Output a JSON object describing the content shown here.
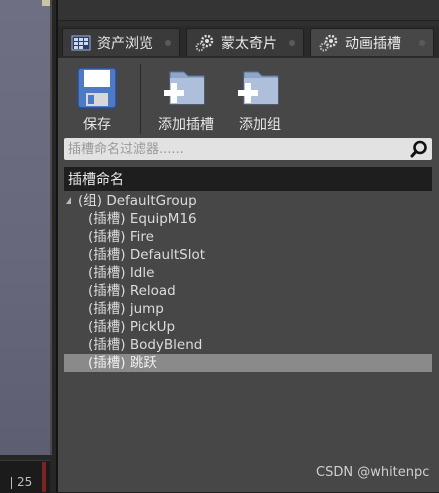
{
  "tabs": [
    {
      "label": "资产浏览",
      "icon": "asset-browser-icon"
    },
    {
      "label": "蒙太奇片",
      "icon": "montage-gear-icon"
    },
    {
      "label": "动画插槽",
      "icon": "anim-slot-gear-icon",
      "active": true
    }
  ],
  "toolbar": {
    "save_label": "保存",
    "add_slot_label": "添加插槽",
    "add_group_label": "添加组"
  },
  "search": {
    "placeholder": "插槽命名过滤器......"
  },
  "list": {
    "header": "插槽命名",
    "group": "(组) DefaultGroup",
    "slots": [
      "(插槽) EquipM16",
      "(插槽) Fire",
      "(插槽) DefaultSlot",
      "(插槽) Idle",
      "(插槽) Reload",
      "(插槽) jump",
      "(插槽) PickUp",
      "(插槽) BodyBlend",
      "(插槽) 跳跃"
    ],
    "selected_slot": "(插槽) 跳跃"
  },
  "timeline": {
    "frame": "25"
  },
  "watermark": "CSDN @whitenpc",
  "colors": {
    "panel_bg": "#474747",
    "tab_bg": "#3a3a3a",
    "header_bg": "#1e1e1e",
    "selected_row": "#8a8a8a",
    "search_bg": "#e2e2e2"
  }
}
